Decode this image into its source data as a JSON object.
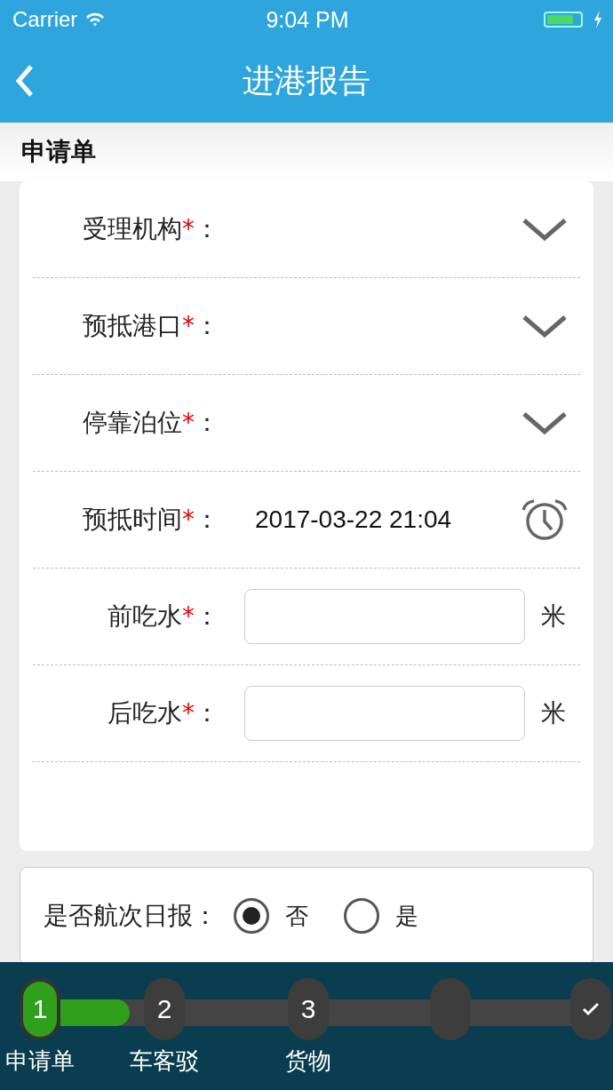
{
  "status_bar": {
    "carrier": "Carrier",
    "time": "9:04 PM"
  },
  "nav": {
    "title": "进港报告"
  },
  "section": {
    "title": "申请单"
  },
  "fields": [
    {
      "kind": "select",
      "label": "受理机构",
      "required_mark": "*",
      "colon": "："
    },
    {
      "kind": "select",
      "label": "预抵港口",
      "required_mark": "*",
      "colon": "："
    },
    {
      "kind": "select",
      "label": "停靠泊位",
      "required_mark": "*",
      "colon": "："
    },
    {
      "kind": "time",
      "label": "预抵时间",
      "required_mark": "*",
      "colon": "：",
      "value": "2017-03-22 21:04"
    },
    {
      "kind": "input",
      "label": "前吃水",
      "required_mark": "*",
      "colon": "：",
      "unit": "米"
    },
    {
      "kind": "input",
      "label": "后吃水",
      "required_mark": "*",
      "colon": "：",
      "unit": "米"
    }
  ],
  "daily_report": {
    "label": "是否航次日报：",
    "options": [
      {
        "label": "否",
        "selected": true
      },
      {
        "label": "是",
        "selected": false
      }
    ]
  },
  "steps": {
    "level": 0.13,
    "items": [
      {
        "number": "1",
        "label": "申请单",
        "selected": true
      },
      {
        "number": "2",
        "label": "车客驳",
        "selected": false
      },
      {
        "number": "3",
        "label": "货物",
        "selected": false
      },
      {
        "selected": false
      },
      {
        "selected": false,
        "kind": "done"
      }
    ]
  }
}
